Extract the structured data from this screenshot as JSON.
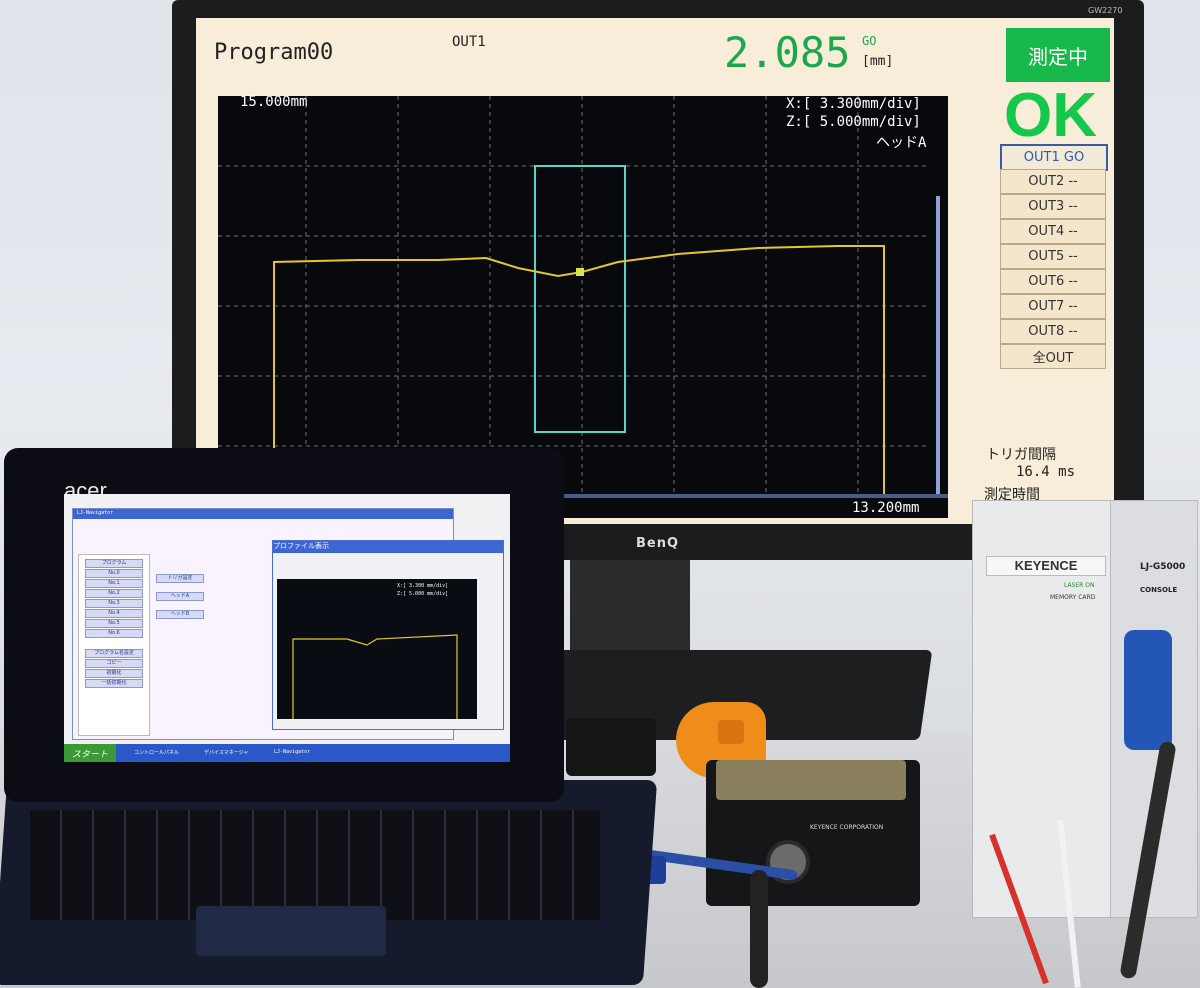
{
  "monitor": {
    "brand": "BenQ",
    "model": "GW2270",
    "display": {
      "program": "Program00",
      "out_label": "OUT1",
      "value": "2.085",
      "judgement_small": "GO",
      "unit": "[mm]",
      "status": "測定中",
      "result": "OK",
      "range_left": "15.000mm",
      "x_div": "X:[   3.300mm/div]",
      "z_div": "Z:[   5.000mm/div]",
      "head": "ヘッドA",
      "range_right": "13.200mm",
      "trigger_label": "トリガ間隔",
      "trigger_value": "16.4 ms",
      "measure_time_label": "測定時間",
      "outputs": [
        "OUT1 GO",
        "OUT2 --",
        "OUT3 --",
        "OUT4 --",
        "OUT5 --",
        "OUT6 --",
        "OUT7 --",
        "OUT8 --",
        "全OUT"
      ]
    },
    "colors": {
      "value_green": "#1aa84a",
      "profile": "#e6c52f",
      "window": "#56d6c8",
      "ok_green": "#16c84a"
    }
  },
  "laptop": {
    "brand": "acer",
    "app_title": "LJ-Navigator",
    "profile_window_title": "プロファイル表示",
    "mini_x_div": "X:[ 3.300 mm/div]",
    "mini_z_div": "Z:[ 5.000 mm/div]",
    "sidebar_items": [
      "プログラム",
      "No.0",
      "No.1",
      "No.2",
      "No.3",
      "No.4",
      "No.5",
      "No.6",
      "プログラム名設定",
      "コピー",
      "初期化",
      "一括初期化"
    ],
    "buttons": [
      "トリガ設定",
      "ヘッドA",
      "ヘッドB"
    ],
    "start_label": "スタート",
    "taskbar_items": [
      "コントロールパネル",
      "デバイスマネージャ",
      "LJ-Navigator"
    ]
  },
  "controller": {
    "brand": "KEYENCE",
    "model": "LJ-G5000",
    "console_label": "CONSOLE",
    "laser_on": "LASER ON",
    "memory_card": "MEMORY CARD"
  },
  "sensor_head": {
    "label": "KEYENCE CORPORATION"
  }
}
